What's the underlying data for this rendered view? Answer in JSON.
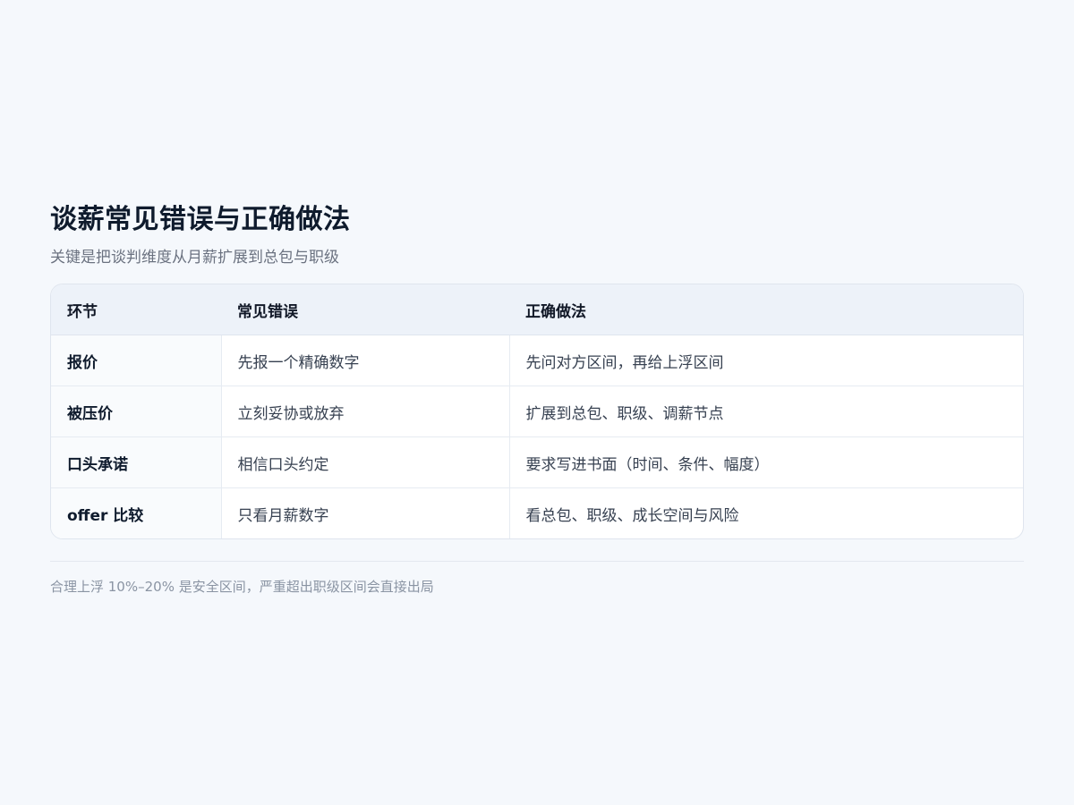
{
  "header": {
    "title": "谈薪常见错误与正确做法",
    "subtitle": "关键是把谈判维度从月薪扩展到总包与职级"
  },
  "table": {
    "columns": [
      "环节",
      "常见错误",
      "正确做法"
    ],
    "rows": [
      {
        "stage": "报价",
        "mistake": "先报一个精确数字",
        "correct": "先问对方区间，再给上浮区间"
      },
      {
        "stage": "被压价",
        "mistake": "立刻妥协或放弃",
        "correct": "扩展到总包、职级、调薪节点"
      },
      {
        "stage": "口头承诺",
        "mistake": "相信口头约定",
        "correct": "要求写进书面（时间、条件、幅度）"
      },
      {
        "stage": "offer 比较",
        "mistake": "只看月薪数字",
        "correct": "看总包、职级、成长空间与风险"
      }
    ]
  },
  "footer": {
    "note": "合理上浮 10%–20% 是安全区间，严重超出职级区间会直接出局"
  }
}
